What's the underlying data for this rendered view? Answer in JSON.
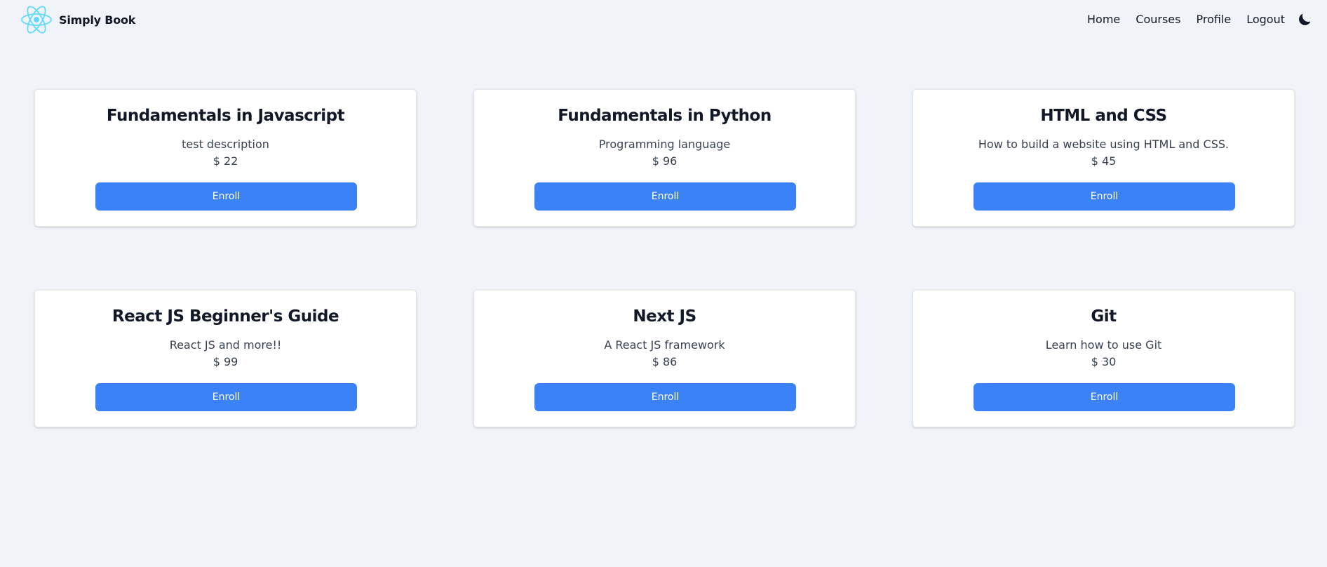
{
  "navbar": {
    "brand_name": "Simply Book",
    "logo_icon": "react-atom-icon",
    "logo_color": "#61dafb",
    "links": [
      "Home",
      "Courses",
      "Profile",
      "Logout"
    ],
    "theme_toggle_icon": "moon-icon"
  },
  "colors": {
    "background": "#f0f3f8",
    "card": "#ffffff",
    "button": "#3b82f6",
    "button_text": "#ffffff"
  },
  "courses": [
    {
      "title": "Fundamentals in Javascript",
      "description": "test description",
      "price": "$ 22",
      "button_label": "Enroll"
    },
    {
      "title": "Fundamentals in Python",
      "description": "Programming language",
      "price": "$ 96",
      "button_label": "Enroll"
    },
    {
      "title": "HTML and CSS",
      "description": "How to build a website using HTML and CSS.",
      "price": "$ 45",
      "button_label": "Enroll"
    },
    {
      "title": "React JS Beginner's Guide",
      "description": "React JS and more!!",
      "price": "$ 99",
      "button_label": "Enroll"
    },
    {
      "title": "Next JS",
      "description": "A React JS framework",
      "price": "$ 86",
      "button_label": "Enroll"
    },
    {
      "title": "Git",
      "description": "Learn how to use Git",
      "price": "$ 30",
      "button_label": "Enroll"
    }
  ]
}
